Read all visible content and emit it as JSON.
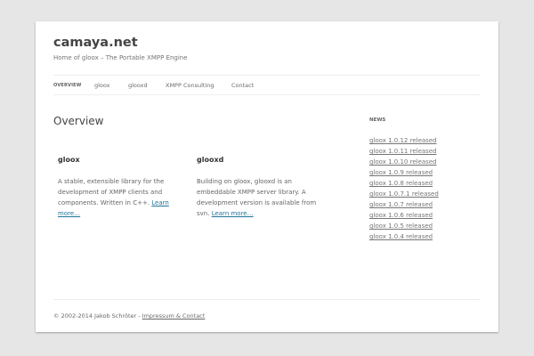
{
  "site": {
    "title": "camaya.net",
    "tagline": "Home of gloox – The Portable XMPP Engine"
  },
  "nav": [
    "Overview",
    "gloox",
    "glooxd",
    "XMPP Consulting",
    "Contact"
  ],
  "main": {
    "heading": "Overview",
    "columns": [
      {
        "title": "gloox",
        "text": "A stable, extensible library for the development of XMPP clients and components. Written in C++. ",
        "link": "Learn more…"
      },
      {
        "title": "glooxd",
        "text": "Building on gloox, glooxd is an embeddable XMPP server library. A development version is available from svn. ",
        "link": "Learn more…"
      }
    ]
  },
  "sidebar": {
    "heading": "News",
    "items": [
      "gloox 1.0.12 released",
      "gloox 1.0.11 released",
      "gloox 1.0.10 released",
      "gloox 1.0.9 released",
      "gloox 1.0.8 released",
      "gloox 1.0.7.1 released",
      "gloox 1.0.7 released",
      "gloox 1.0.6 released",
      "gloox 1.0.5 released",
      "gloox 1.0.4 released"
    ]
  },
  "footer": {
    "copyright": "© 2002-2014 Jakob Schröter - ",
    "link": "Impressum & Contact"
  }
}
